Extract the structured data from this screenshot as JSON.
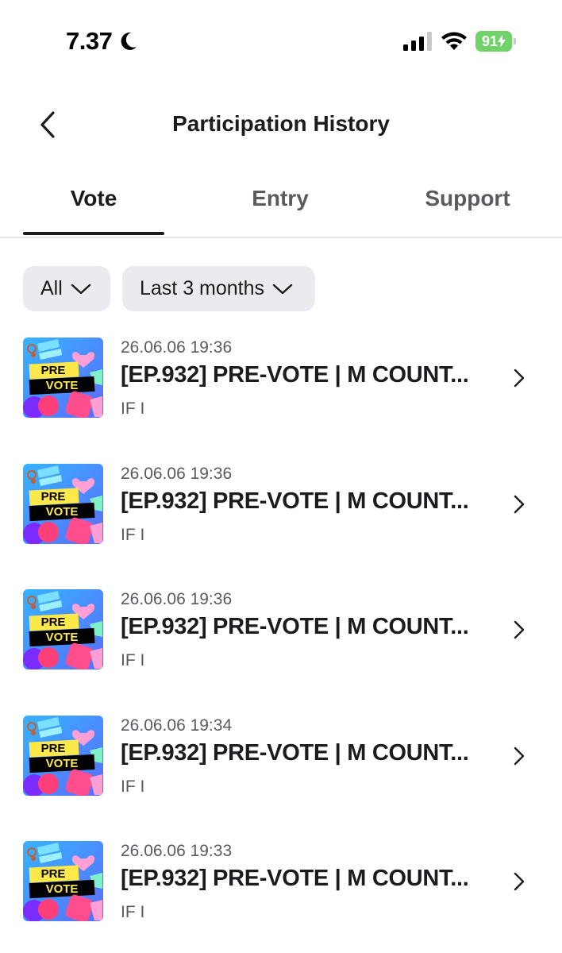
{
  "status_bar": {
    "time": "7.37",
    "battery": "91"
  },
  "header": {
    "title": "Participation History"
  },
  "tabs": [
    {
      "label": "Vote",
      "active": true
    },
    {
      "label": "Entry",
      "active": false
    },
    {
      "label": "Support",
      "active": false
    }
  ],
  "filters": {
    "type": "All",
    "period": "Last 3 months"
  },
  "items": [
    {
      "date": "26.06.06 19:36",
      "title": "[EP.932] PRE-VOTE | M COUNT...",
      "subtitle": "IF I",
      "thumb_line1": "PRE",
      "thumb_line2": "VOTE"
    },
    {
      "date": "26.06.06 19:36",
      "title": "[EP.932] PRE-VOTE | M COUNT...",
      "subtitle": "IF I",
      "thumb_line1": "PRE",
      "thumb_line2": "VOTE"
    },
    {
      "date": "26.06.06 19:36",
      "title": "[EP.932] PRE-VOTE | M COUNT...",
      "subtitle": "IF I",
      "thumb_line1": "PRE",
      "thumb_line2": "VOTE"
    },
    {
      "date": "26.06.06 19:34",
      "title": "[EP.932] PRE-VOTE | M COUNT...",
      "subtitle": "IF I",
      "thumb_line1": "PRE",
      "thumb_line2": "VOTE"
    },
    {
      "date": "26.06.06 19:33",
      "title": "[EP.932] PRE-VOTE | M COUNT...",
      "subtitle": "IF I",
      "thumb_line1": "PRE",
      "thumb_line2": "VOTE"
    }
  ],
  "colors": {
    "battery": "#6fd36a",
    "filter_bg": "#ebebef",
    "text_primary": "#1c1c1e",
    "text_secondary": "#5a5a5f"
  },
  "icons": {
    "back": "chevron-left-icon",
    "dropdown": "chevron-down-icon",
    "row_arrow": "chevron-right-icon",
    "moon": "moon-icon",
    "signal": "cellular-signal-icon",
    "wifi": "wifi-icon",
    "battery": "battery-icon"
  }
}
